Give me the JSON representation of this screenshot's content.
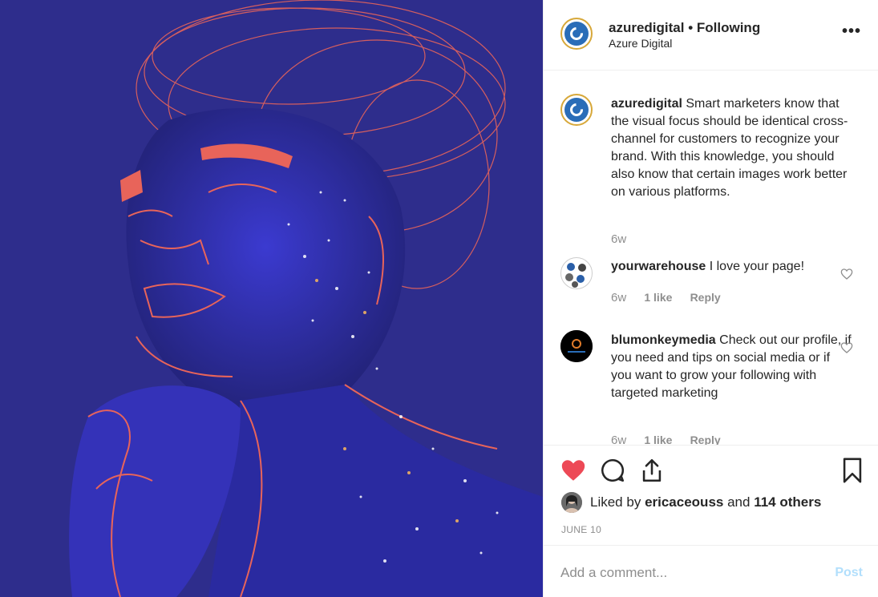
{
  "post": {
    "username": "azuredigital",
    "separator": "•",
    "follow_status": "Following",
    "display_name": "Azure Digital",
    "more_label": "•••",
    "caption": {
      "username": "azuredigital",
      "text": "Smart marketers know that the visual focus should be identical cross-channel for customers to recognize your brand. With this knowledge, you should also know that certain images work better on various platforms.",
      "age": "6w"
    },
    "comments": [
      {
        "username": "yourwarehouse",
        "text": "I love your page!",
        "age": "6w",
        "likes": "1 like",
        "reply": "Reply"
      },
      {
        "username": "blumonkeymedia",
        "text": "Check out our profile, if you need and tips on social media or if you want to grow your following with targeted marketing",
        "age": "6w",
        "likes": "1 like",
        "reply": "Reply"
      }
    ],
    "liked_by_prefix": "Liked by",
    "liked_by_user": "ericaceouss",
    "liked_by_and": "and",
    "liked_by_others": "114 others",
    "date": "JUNE 10",
    "comment_placeholder": "Add a comment...",
    "post_button": "Post"
  },
  "colors": {
    "photo_bg": "#2e2d8c",
    "line_art": "#e8645a",
    "like_red": "#ed4956",
    "post_disabled": "#b2dffc"
  },
  "icons": [
    "heart-filled-icon",
    "comment-icon",
    "share-icon",
    "bookmark-icon",
    "heart-outline-icon",
    "more-options-icon"
  ]
}
